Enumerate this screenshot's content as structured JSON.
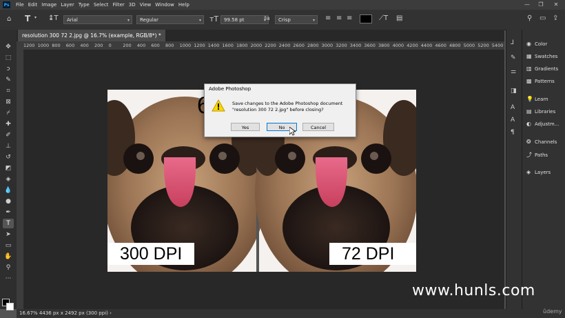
{
  "menubar": {
    "logo": "Ps",
    "items": [
      "File",
      "Edit",
      "Image",
      "Layer",
      "Type",
      "Select",
      "Filter",
      "3D",
      "View",
      "Window",
      "Help"
    ],
    "window_controls": [
      "—",
      "❐",
      "✕"
    ]
  },
  "options": {
    "font_family": "Arial",
    "font_style": "Regular",
    "font_size": "99.58 pt",
    "antialias": "Crisp",
    "text_color": "#000000"
  },
  "document": {
    "tab_title": "resolution 300 72 2.jpg @ 16.7% (example, RGB/8*) *",
    "ruler_ticks": [
      "1200",
      "1000",
      "800",
      "600",
      "400",
      "200",
      "0",
      "200",
      "400",
      "600",
      "800",
      "1000",
      "1200",
      "1400",
      "1600",
      "1800",
      "2000",
      "2200",
      "2400",
      "2600",
      "2800",
      "3000",
      "3200",
      "3400",
      "3600",
      "3800",
      "4000",
      "4200",
      "4400",
      "4600",
      "4800",
      "5000",
      "5200",
      "5400"
    ],
    "left_label": "300 DPI",
    "right_label": "72 DPI",
    "partial_text": "6"
  },
  "dialog": {
    "title": "Adobe Photoshop",
    "message_line1": "Save changes to the Adobe Photoshop document",
    "message_line2": "\"resolution 300 72 2.jpg\" before closing?",
    "yes_label": "Yes",
    "no_label": "No",
    "cancel_label": "Cancel"
  },
  "panels": {
    "group1": [
      "Color",
      "Swatches",
      "Gradients",
      "Patterns"
    ],
    "group2": [
      "Learn",
      "Libraries",
      "Adjustm..."
    ],
    "group3": [
      "Channels",
      "Paths"
    ],
    "group4": [
      "Layers"
    ]
  },
  "status": {
    "text": "16.67%   4436 px x 2492 px (300 ppi)   ›"
  },
  "watermark": "www.hunls.com",
  "brand": "ûdemy"
}
